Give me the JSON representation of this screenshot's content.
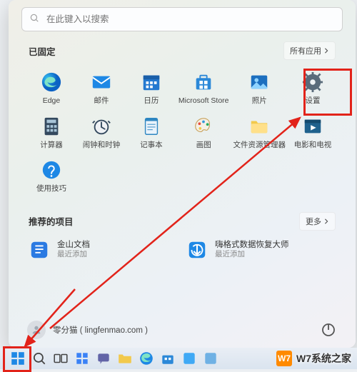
{
  "search": {
    "placeholder": "在此键入以搜索"
  },
  "pinned": {
    "title": "已固定",
    "all_apps_label": "所有应用",
    "tiles": [
      {
        "name": "edge",
        "label": "Edge"
      },
      {
        "name": "mail",
        "label": "邮件"
      },
      {
        "name": "calendar",
        "label": "日历"
      },
      {
        "name": "microsoft-store",
        "label": "Microsoft Store"
      },
      {
        "name": "photos",
        "label": "照片"
      },
      {
        "name": "settings",
        "label": "设置"
      },
      {
        "name": "calculator",
        "label": "计算器"
      },
      {
        "name": "alarms",
        "label": "闹钟和时钟"
      },
      {
        "name": "notepad",
        "label": "记事本"
      },
      {
        "name": "paint",
        "label": "画图"
      },
      {
        "name": "file-explorer",
        "label": "文件资源管理器"
      },
      {
        "name": "movies-tv",
        "label": "电影和电视"
      },
      {
        "name": "tips",
        "label": "使用技巧"
      }
    ]
  },
  "recommended": {
    "title": "推荐的项目",
    "more_label": "更多",
    "items": [
      {
        "name": "jinshan-docs",
        "title": "金山文档",
        "subtitle": "最近添加"
      },
      {
        "name": "recovery-master",
        "title": "嗨格式数据恢复大师",
        "subtitle": "最近添加"
      }
    ]
  },
  "user": {
    "display": "零分猫 ( lingfenmao.com )"
  },
  "watermark": {
    "text": "W7系统之家",
    "logo_text": "W7"
  },
  "colors": {
    "edge": "#1e73d2",
    "mail": "#1e88e5",
    "calendar": "#2479d0",
    "store": "#2b88d8",
    "photos": "#1c6fbf",
    "settings": "#5a6b7b",
    "calculator": "#34495e",
    "alarms": "#34495e",
    "notepad": "#2e86c1",
    "paint": "#f2c94c",
    "explorer": "#f2c94c",
    "movies": "#1f618d",
    "tips": "#1e88e5",
    "jinshan": "#2a7ae2",
    "recovery": "#1e88e5",
    "highlight": "#e2231a"
  }
}
